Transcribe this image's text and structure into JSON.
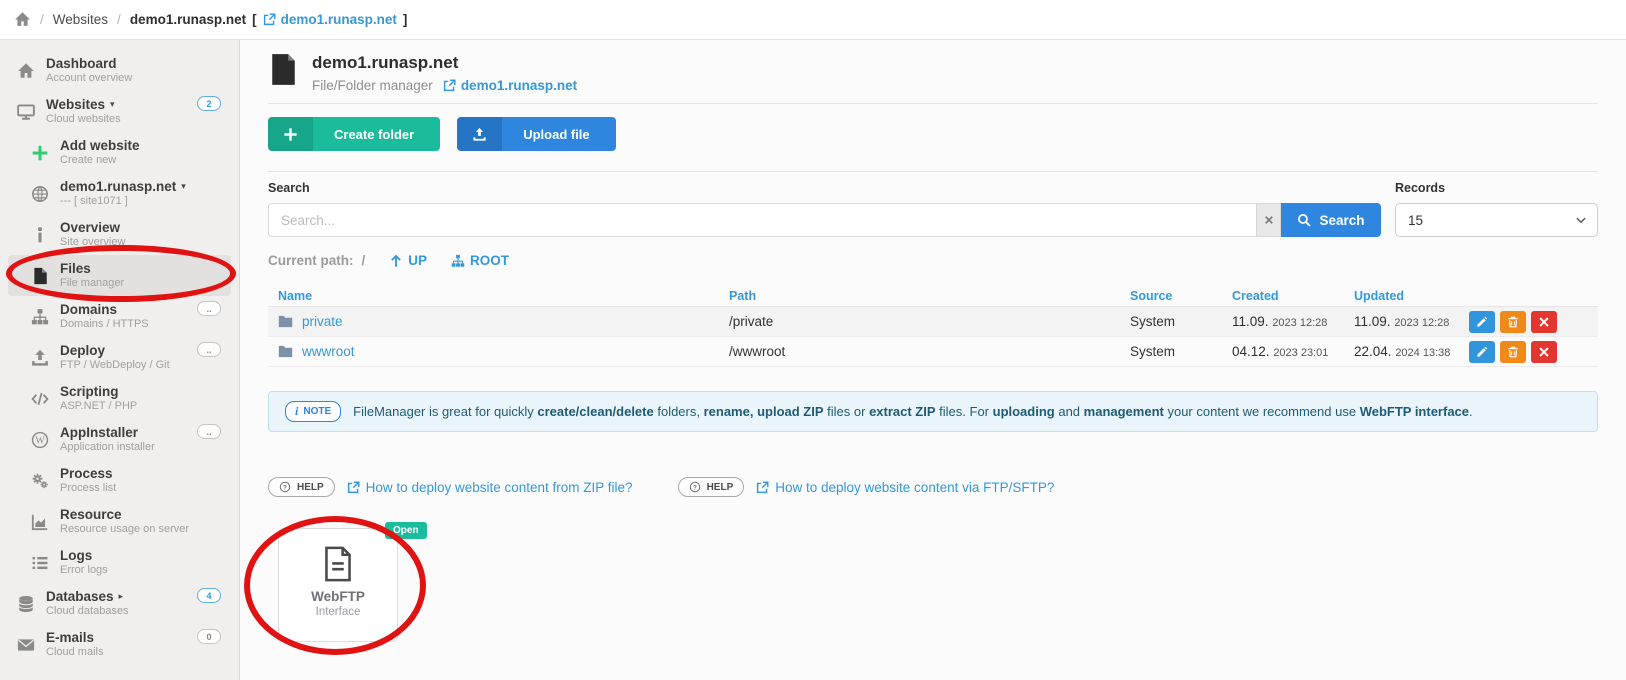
{
  "breadcrumb": {
    "sep": "/",
    "websites": "Websites",
    "current": "demo1.runasp.net",
    "bracket_open": "[",
    "link": "demo1.runasp.net",
    "bracket_close": "]"
  },
  "sidebar": {
    "items": [
      {
        "id": "dashboard",
        "icon": "home",
        "label": "Dashboard",
        "sub": "Account overview",
        "indent": 0
      },
      {
        "id": "websites",
        "icon": "monitor",
        "label": "Websites",
        "caret": "▾",
        "sub": "Cloud websites",
        "badge": "2",
        "badge_style": "blue",
        "indent": 0
      },
      {
        "id": "add-website",
        "icon": "plus",
        "label": "Add website",
        "sub": "Create new",
        "indent": 1,
        "icon_color": "#2ecc71"
      },
      {
        "id": "site",
        "icon": "globe",
        "label": "demo1.runasp.net",
        "caret": "▾",
        "sub": "--- [ site1071 ]",
        "indent": 1
      },
      {
        "id": "overview",
        "icon": "info",
        "label": "Overview",
        "sub": "Site overview",
        "indent": 1
      },
      {
        "id": "files",
        "icon": "file",
        "label": "Files",
        "sub": "File manager",
        "indent": 1,
        "selected": true
      },
      {
        "id": "domains",
        "icon": "sitemap",
        "label": "Domains",
        "sub": "Domains / HTTPS",
        "badge": "..",
        "badge_style": "gray",
        "indent": 1
      },
      {
        "id": "deploy",
        "icon": "upload",
        "label": "Deploy",
        "sub": "FTP / WebDeploy / Git",
        "badge": "..",
        "badge_style": "gray",
        "indent": 1
      },
      {
        "id": "scripting",
        "icon": "code",
        "label": "Scripting",
        "sub": "ASP.NET / PHP",
        "indent": 1
      },
      {
        "id": "appinstaller",
        "icon": "wordpress",
        "label": "AppInstaller",
        "sub": "Application installer",
        "badge": "..",
        "badge_style": "gray",
        "indent": 1
      },
      {
        "id": "process",
        "icon": "gears",
        "label": "Process",
        "sub": "Process list",
        "indent": 1
      },
      {
        "id": "resource",
        "icon": "chart",
        "label": "Resource",
        "sub": "Resource usage on server",
        "indent": 1
      },
      {
        "id": "logs",
        "icon": "list",
        "label": "Logs",
        "sub": "Error logs",
        "indent": 1
      },
      {
        "id": "databases",
        "icon": "database",
        "label": "Databases",
        "caret": "▸",
        "sub": "Cloud databases",
        "badge": "4",
        "badge_style": "blue",
        "indent": 0
      },
      {
        "id": "emails",
        "icon": "envelope",
        "label": "E-mails",
        "sub": "Cloud mails",
        "badge": "0",
        "badge_style": "gray",
        "indent": 0
      }
    ]
  },
  "header": {
    "title": "demo1.runasp.net",
    "subtitle": "File/Folder manager",
    "link": "demo1.runasp.net"
  },
  "toolbar": {
    "create_folder": "Create folder",
    "upload_file": "Upload file"
  },
  "search": {
    "label": "Search",
    "placeholder": "Search...",
    "button": "Search"
  },
  "records": {
    "label": "Records",
    "value": "15"
  },
  "pathbar": {
    "label": "Current path:",
    "path": "/",
    "up": "UP",
    "root": "ROOT"
  },
  "table": {
    "headers": [
      "Name",
      "Path",
      "Source",
      "Created",
      "Updated"
    ],
    "rows": [
      {
        "name": "private",
        "path": "/private",
        "source": "System",
        "created_day": "11.09.",
        "created_time": "2023 12:28",
        "updated_day": "11.09.",
        "updated_time": "2023 12:28"
      },
      {
        "name": "wwwroot",
        "path": "/wwwroot",
        "source": "System",
        "created_day": "04.12.",
        "created_time": "2023 23:01",
        "updated_day": "22.04.",
        "updated_time": "2024 13:38"
      }
    ]
  },
  "note": {
    "badge_icon": "i",
    "badge": "NOTE",
    "segments": [
      {
        "t": "FileManager is great for quickly "
      },
      {
        "t": "create/clean/delete",
        "b": 1
      },
      {
        "t": " folders, "
      },
      {
        "t": "rename,",
        "b": 1
      },
      {
        "t": " "
      },
      {
        "t": "upload ZIP",
        "b": 1
      },
      {
        "t": " files or "
      },
      {
        "t": "extract ZIP",
        "b": 1
      },
      {
        "t": " files. For "
      },
      {
        "t": "uploading",
        "b": 1
      },
      {
        "t": " and "
      },
      {
        "t": "management",
        "b": 1
      },
      {
        "t": " your content we recommend use "
      },
      {
        "t": "WebFTP interface",
        "b": 1
      },
      {
        "t": "."
      }
    ]
  },
  "help": {
    "badge": "HELP",
    "items": [
      {
        "label": "How to deploy website content from ZIP file?"
      },
      {
        "label": "How to deploy website content via FTP/SFTP?"
      }
    ]
  },
  "webftp": {
    "badge": "Open",
    "title": "WebFTP",
    "subtitle": "Interface"
  },
  "annotations": {
    "shape": "red-ellipse",
    "color": "#e01212",
    "targets": [
      "sidebar-item-files",
      "webftp-tile"
    ]
  },
  "colors": {
    "link_blue": "#3498db",
    "button_blue": "#2e86de",
    "button_teal": "#1abc9c",
    "action_edit": "#3195dc",
    "action_delete": "#ef8918",
    "action_remove": "#e23730",
    "note_bg": "#e9f5fa",
    "sidebar_bg": "#f0efee",
    "annotation_red": "#e01212"
  }
}
